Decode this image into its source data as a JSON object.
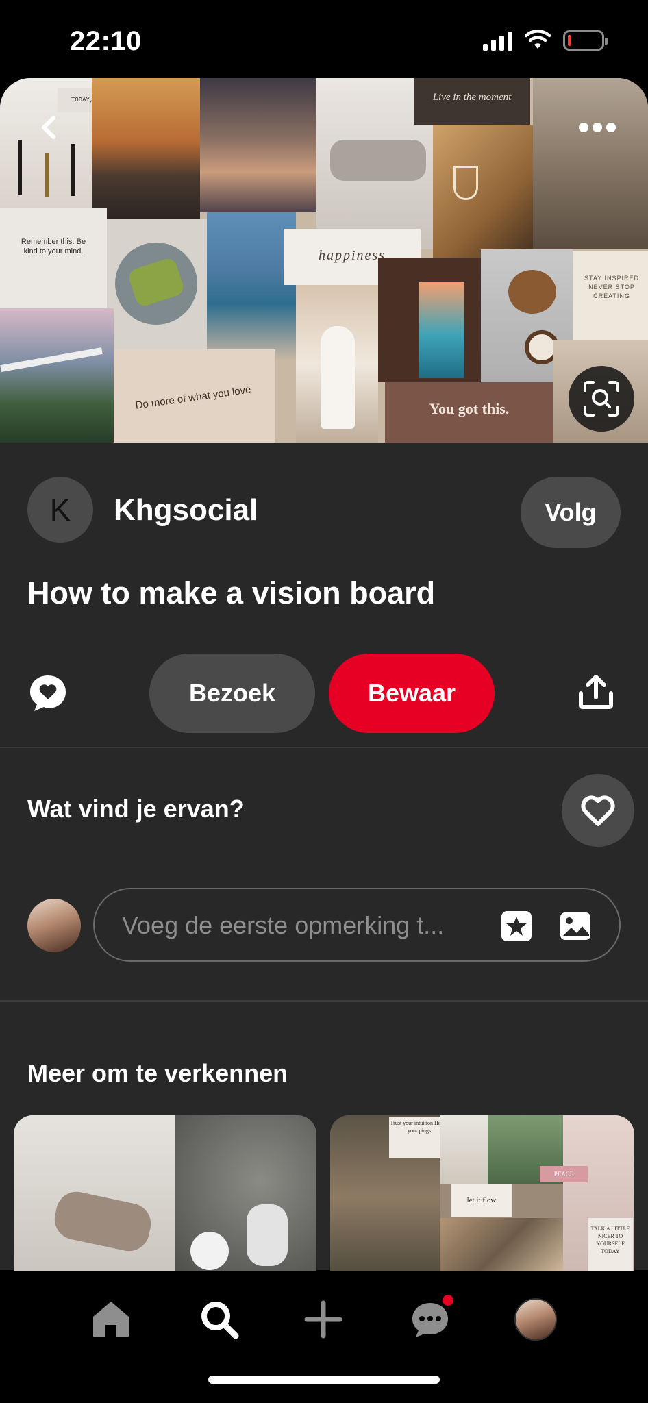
{
  "status_bar": {
    "time": "22:10"
  },
  "hero": {
    "texts": {
      "today": "TODAY, I WILL",
      "live": "Live in the moment",
      "remember": "Remember this: Be kind to your mind.",
      "happiness": "happiness",
      "stay": "STAY INSPIRED NEVER STOP CREATING",
      "do_more": "Do more of what you love",
      "you_got": "You got this."
    }
  },
  "pin": {
    "author_initial": "K",
    "author": "Khgsocial",
    "follow_label": "Volg",
    "title": "How to make a vision board",
    "visit_label": "Bezoek",
    "save_label": "Bewaar"
  },
  "reactions": {
    "question": "Wat vind je ervan?"
  },
  "comment": {
    "placeholder": "Voeg de eerste opmerking t..."
  },
  "explore": {
    "title": "Meer om te verkennen",
    "right_thumb_texts": {
      "trust": "Trust your intuition Honor your pings",
      "let_it_flow": "let it flow",
      "peace": "PEACE",
      "talk": "TALK A LITTLE NICER TO YOURSELF TODAY"
    }
  },
  "colors": {
    "accent": "#e60023",
    "surface": "#282828",
    "pill": "#4a4a4a"
  },
  "nav": {
    "items": [
      "home-icon",
      "search-icon",
      "plus-icon",
      "messages-icon",
      "profile-avatar"
    ]
  }
}
